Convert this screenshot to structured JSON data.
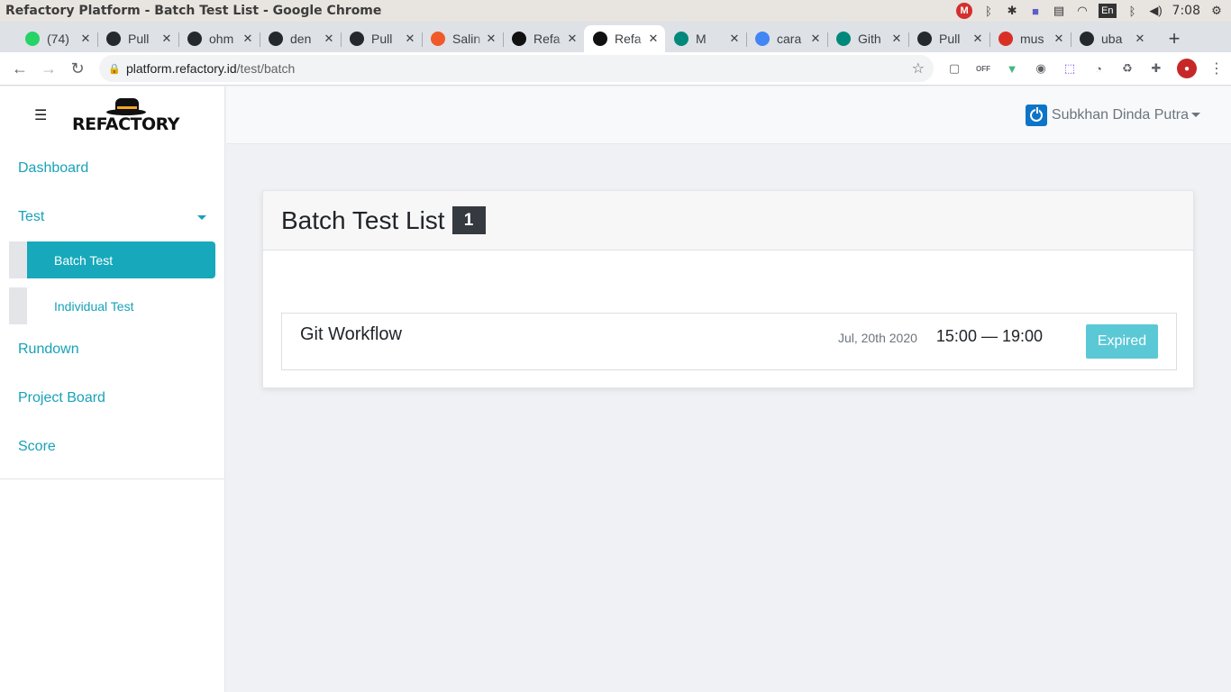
{
  "os": {
    "window_title": "Refactory Platform - Batch Test List - Google Chrome",
    "tray": {
      "mega_letter": "M",
      "lang": "En",
      "time": "7:08"
    }
  },
  "browser": {
    "tabs": [
      {
        "label": "(74)",
        "icon": "whatsapp-icon",
        "color": "#25d366",
        "active": false
      },
      {
        "label": "Pull",
        "icon": "github-icon",
        "color": "#24292e",
        "active": false
      },
      {
        "label": "ohm",
        "icon": "github-icon",
        "color": "#24292e",
        "active": false
      },
      {
        "label": "den",
        "icon": "github-icon",
        "color": "#24292e",
        "active": false
      },
      {
        "label": "Pull",
        "icon": "github-icon",
        "color": "#24292e",
        "active": false
      },
      {
        "label": "Salin",
        "icon": "p-icon",
        "color": "#f05a28",
        "active": false
      },
      {
        "label": "Refa",
        "icon": "refactory-hat-icon",
        "color": "#111111",
        "active": false
      },
      {
        "label": "Refa",
        "icon": "refactory-hat-icon",
        "color": "#111111",
        "active": true
      },
      {
        "label": "M",
        "icon": "meet-icon",
        "color": "#00897b",
        "active": false
      },
      {
        "label": "cara",
        "icon": "google-icon",
        "color": "#4285f4",
        "active": false
      },
      {
        "label": "Gith",
        "icon": "globe-icon",
        "color": "#00897b",
        "active": false
      },
      {
        "label": "Pull",
        "icon": "github-icon",
        "color": "#24292e",
        "active": false
      },
      {
        "label": "mus",
        "icon": "gmail-icon",
        "color": "#d93025",
        "active": false
      },
      {
        "label": "uba",
        "icon": "github-icon",
        "color": "#24292e",
        "active": false
      }
    ],
    "close_glyph": "✕",
    "new_tab_glyph": "+",
    "url_host": "platform.refactory.id",
    "url_path": "/test/batch",
    "off_badge": "OFF"
  },
  "sidebar": {
    "logo_text": "REFACTORY",
    "items": [
      {
        "label": "Dashboard"
      },
      {
        "label": "Test"
      },
      {
        "label": "Rundown"
      },
      {
        "label": "Project Board"
      },
      {
        "label": "Score"
      }
    ],
    "test_sub": [
      {
        "label": "Batch Test",
        "active": true
      },
      {
        "label": "Individual Test",
        "active": false
      }
    ]
  },
  "header": {
    "user_name": "Subkhan Dinda Putra"
  },
  "main": {
    "title": "Batch Test List",
    "count": "1",
    "tests": [
      {
        "name": "Git Workflow",
        "date": "Jul, 20th 2020",
        "time": "15:00 — 19:00",
        "status": "Expired"
      }
    ]
  },
  "colors": {
    "accent": "#17a2b8",
    "active_item_bg": "#17a9bb",
    "expired_bg": "#5bc8d6",
    "badge_bg": "#343a40",
    "user_icon_bg": "#0d74c8"
  }
}
